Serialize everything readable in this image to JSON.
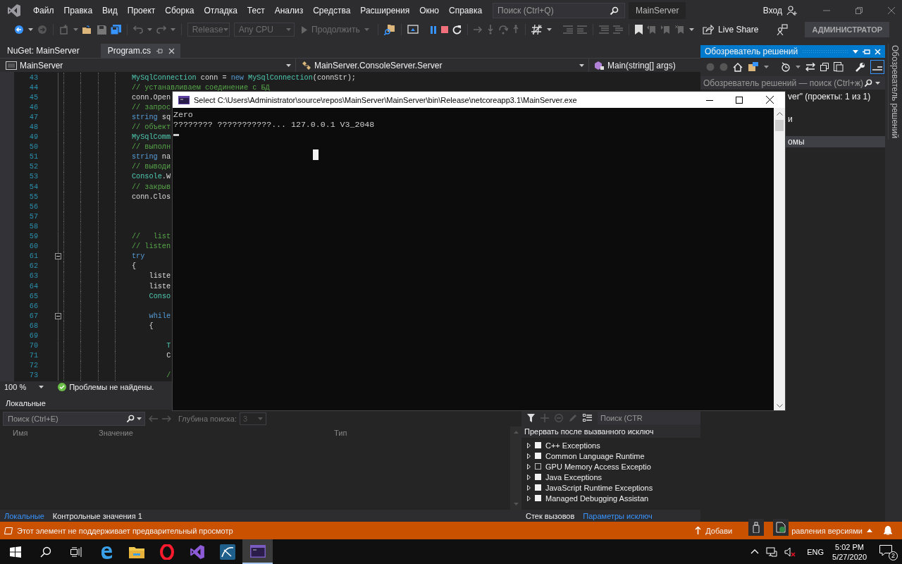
{
  "window": {
    "menu": [
      "Файл",
      "Правка",
      "Вид",
      "Проект",
      "Сборка",
      "Отладка",
      "Тест",
      "Анализ",
      "Средства",
      "Расширения",
      "Окно",
      "Справка"
    ],
    "search": {
      "placeholder": "Поиск (Ctrl+Q)"
    },
    "solution_name": "MainServer",
    "sign_in": "Вход"
  },
  "toolbar": {
    "configuration": "Release",
    "platform": "Any CPU",
    "continue": "Продолжить",
    "live_share": "Live Share",
    "account": "АДМИНИСТРАТОР"
  },
  "tabs": [
    {
      "label": "NuGet: MainServer",
      "selected": false
    },
    {
      "label": "Program.cs",
      "selected": true
    }
  ],
  "nav_bar": {
    "project": "MainServer",
    "class": "MainServer.ConsoleServer.Server",
    "member": "Main(string[] args)"
  },
  "code": {
    "lines": [
      {
        "number": "43",
        "tokens": [
          {
            "kind": "type",
            "text": "MySqlConnection"
          },
          {
            "kind": "plain",
            "text": " conn = "
          },
          {
            "kind": "keyword",
            "text": "new"
          },
          {
            "kind": "type",
            "text": " MySqlConnection"
          },
          {
            "kind": "plain",
            "text": "(connStr);"
          }
        ]
      },
      {
        "number": "44",
        "tokens": [
          {
            "kind": "comment",
            "text": "// устанавливаем соединение с БД"
          }
        ]
      },
      {
        "number": "45",
        "tokens": [
          {
            "kind": "plain",
            "text": "conn.Open"
          }
        ]
      },
      {
        "number": "46",
        "tokens": [
          {
            "kind": "comment",
            "text": "// запрос"
          }
        ]
      },
      {
        "number": "47",
        "tokens": [
          {
            "kind": "keyword",
            "text": "string"
          },
          {
            "kind": "plain",
            "text": " sq"
          }
        ]
      },
      {
        "number": "48",
        "tokens": [
          {
            "kind": "comment",
            "text": "// объект"
          }
        ]
      },
      {
        "number": "49",
        "tokens": [
          {
            "kind": "type",
            "text": "MySqlComm"
          }
        ]
      },
      {
        "number": "50",
        "tokens": [
          {
            "kind": "comment",
            "text": "// выполн"
          }
        ]
      },
      {
        "number": "51",
        "tokens": [
          {
            "kind": "keyword",
            "text": "string"
          },
          {
            "kind": "plain",
            "text": " na"
          }
        ]
      },
      {
        "number": "52",
        "tokens": [
          {
            "kind": "comment",
            "text": "// выводи"
          }
        ]
      },
      {
        "number": "53",
        "tokens": [
          {
            "kind": "type",
            "text": "Console"
          },
          {
            "kind": "plain",
            "text": ".W"
          }
        ]
      },
      {
        "number": "54",
        "tokens": [
          {
            "kind": "comment",
            "text": "// закрыв"
          }
        ]
      },
      {
        "number": "55",
        "tokens": [
          {
            "kind": "plain",
            "text": "conn.Clos"
          }
        ]
      },
      {
        "number": "56"
      },
      {
        "number": "57"
      },
      {
        "number": "58"
      },
      {
        "number": "59",
        "tokens": [
          {
            "kind": "comment",
            "text": "//   list"
          }
        ]
      },
      {
        "number": "60",
        "tokens": [
          {
            "kind": "comment",
            "text": "// listen"
          }
        ]
      },
      {
        "number": "61",
        "fold_expanded": true,
        "tokens": [
          {
            "kind": "keyword",
            "text": "try"
          }
        ]
      },
      {
        "number": "62",
        "tokens": [
          {
            "kind": "plain",
            "text": "{"
          }
        ],
        "children": [
          {
            "number": "63",
            "tokens": [
              {
                "kind": "plain",
                "text": "liste"
              }
            ]
          },
          {
            "number": "64",
            "tokens": [
              {
                "kind": "plain",
                "text": "liste"
              }
            ]
          },
          {
            "number": "65",
            "tokens": [
              {
                "kind": "type",
                "text": "Conso"
              }
            ]
          },
          {
            "number": "66"
          },
          {
            "number": "67",
            "fold_expanded": true,
            "tokens": [
              {
                "kind": "keyword",
                "text": "while"
              }
            ]
          },
          {
            "number": "68",
            "tokens": [
              {
                "kind": "plain",
                "text": "{"
              }
            ],
            "children": [
              {
                "number": "69"
              },
              {
                "number": "70",
                "tokens": [
                  {
                    "kind": "type",
                    "text": "T"
                  }
                ]
              },
              {
                "number": "71",
                "tokens": [
                  {
                    "kind": "plain",
                    "text": "C"
                  }
                ]
              },
              {
                "number": "72"
              },
              {
                "number": "73",
                "tokens": [
                  {
                    "kind": "comment",
                    "text": "/"
                  }
                ]
              }
            ]
          }
        ]
      }
    ]
  },
  "editor_status": {
    "zoom": "100 %",
    "issues": "Проблемы не найдены."
  },
  "locals": {
    "title": "Локальные",
    "search": {
      "placeholder": "Поиск (Ctrl+E)"
    },
    "depth_label": "Глубина поиска:",
    "depth": "3",
    "columns": [
      "Имя",
      "Значение",
      "Тип"
    ],
    "tabs": [
      {
        "label": "Локальные",
        "selected": true
      },
      {
        "label": "Контрольные значения 1",
        "selected": false
      }
    ]
  },
  "exceptions": {
    "search": {
      "placeholder": "Поиск (CTR"
    },
    "header": "Прервать после вызванного исключ",
    "items": [
      {
        "label": "C++ Exceptions",
        "checked": true
      },
      {
        "label": "Common Language Runtime",
        "checked": true
      },
      {
        "label": "GPU Memory Access Exceptio",
        "checked": false
      },
      {
        "label": "Java Exceptions",
        "checked": true
      },
      {
        "label": "JavaScript Runtime Exceptions",
        "checked": true
      },
      {
        "label": "Managed Debugging Assistan",
        "checked": true
      }
    ],
    "tabs": [
      {
        "label": "Стек вызовов",
        "selected": false
      },
      {
        "label": "Параметры исключ",
        "selected": true
      }
    ]
  },
  "solution_explorer": {
    "title": "Обозреватель решений",
    "search": {
      "placeholder": "Обозреватель решений — поиск (Ctrl+ж)"
    },
    "items": [
      {
        "label": "ver\" (проекты: 1 из 1)",
        "selected": false
      },
      {
        "label": "и",
        "selected": false
      },
      {
        "label": "омы",
        "selected": true
      }
    ],
    "side_tab": "Обозреватель решений"
  },
  "console": {
    "title": "Select C:\\Users\\Administrator\\source\\repos\\MainServer\\MainServer\\bin\\Release\\netcoreapp3.1\\MainServer.exe",
    "lines": [
      "Zero",
      "???????? ???????????... 127.0.0.1 V3_2048"
    ]
  },
  "status_bar": {
    "message": "Этот элемент не поддерживает предварительный просмотр",
    "source_control_start": "Добави",
    "source_control_end": "равления версиями"
  },
  "taskbar": {
    "apps": [
      {
        "kind": "browser",
        "selected": false
      },
      {
        "kind": "folder",
        "selected": false
      },
      {
        "kind": "ring",
        "selected": false
      },
      {
        "kind": "ide",
        "selected": false
      },
      {
        "kind": "workbench",
        "selected": false
      },
      {
        "kind": "console",
        "selected": true
      }
    ],
    "language": "ENG",
    "time": "5:02 PM",
    "date": "5/27/2020",
    "notifications": "2"
  }
}
